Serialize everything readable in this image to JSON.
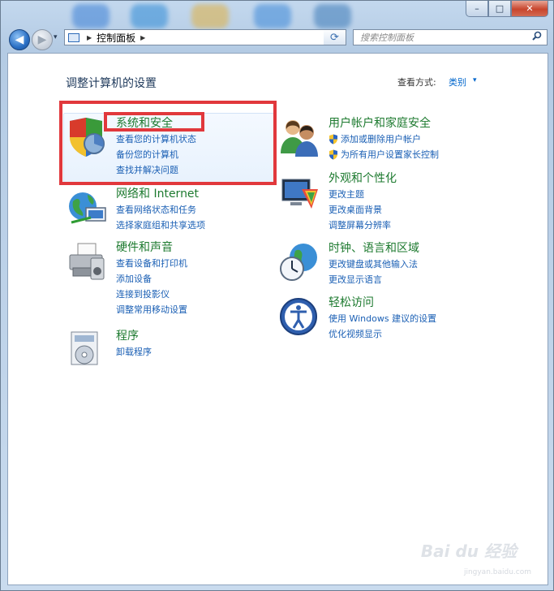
{
  "window": {
    "controls": {
      "minimize": "–",
      "maximize": "□",
      "close": "✕"
    }
  },
  "navigation": {
    "back_icon": "◀",
    "forward_icon": "▶",
    "recent_icon": "▾",
    "address_segments": [
      "控制面板"
    ],
    "address_sep": "▶",
    "refresh_icon": "⟳",
    "search_placeholder": "搜索控制面板",
    "search_icon": "search-icon"
  },
  "header": {
    "title": "调整计算机的设置",
    "view_by_label": "查看方式:",
    "view_by_value": "类别",
    "view_by_arrow": "▾"
  },
  "categories": [
    {
      "id": "system",
      "title": "系统和安全",
      "icon": "shield-icon",
      "links": [
        "查看您的计算机状态",
        "备份您的计算机",
        "查找并解决问题"
      ]
    },
    {
      "id": "network",
      "title": "网络和 Internet",
      "icon": "globe-network-icon",
      "links": [
        "查看网络状态和任务",
        "选择家庭组和共享选项"
      ]
    },
    {
      "id": "hardware",
      "title": "硬件和声音",
      "icon": "printer-icon",
      "links": [
        "查看设备和打印机",
        "添加设备",
        "连接到投影仪",
        "调整常用移动设置"
      ]
    },
    {
      "id": "programs",
      "title": "程序",
      "icon": "programs-icon",
      "links": [
        "卸载程序"
      ]
    },
    {
      "id": "accounts",
      "title": "用户帐户和家庭安全",
      "icon": "users-icon",
      "links": [
        "添加或删除用户帐户",
        "为所有用户设置家长控制"
      ]
    },
    {
      "id": "appearance",
      "title": "外观和个性化",
      "icon": "palette-monitor-icon",
      "links": [
        "更改主题",
        "更改桌面背景",
        "调整屏幕分辨率"
      ]
    },
    {
      "id": "clock",
      "title": "时钟、语言和区域",
      "icon": "clock-globe-icon",
      "links": [
        "更改键盘或其他输入法",
        "更改显示语言"
      ]
    },
    {
      "id": "ease",
      "title": "轻松访问",
      "icon": "accessibility-icon",
      "links": [
        "使用 Windows 建议的设置",
        "优化视频显示"
      ]
    }
  ],
  "colors": {
    "category_title": "#1d7a2f",
    "link": "#1a5fb4",
    "highlight": "#e1383c"
  },
  "watermark": {
    "brand": "Bai du 经验",
    "url": "jingyan.baidu.com"
  }
}
